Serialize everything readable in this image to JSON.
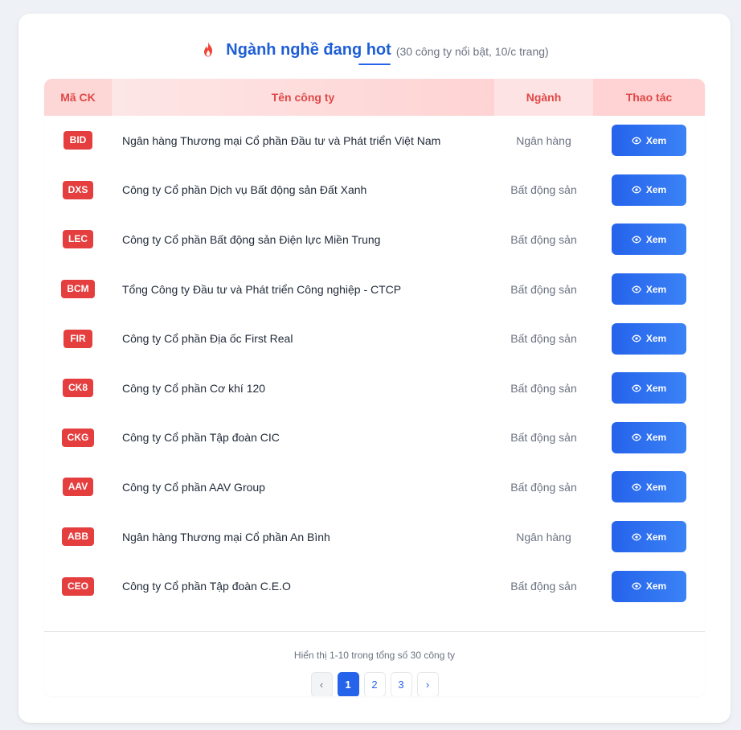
{
  "header": {
    "icon": "fire-icon",
    "title": "Ngành nghề đang hot",
    "subtitle": "(30 công ty nổi bật, 10/c trang)"
  },
  "table": {
    "columns": [
      "Mã CK",
      "Tên công ty",
      "Ngành",
      "Thao tác"
    ],
    "rows": [
      {
        "ticker": "BID",
        "name": "Ngân hàng Thương mại Cổ phần Đầu tư và Phát triển Việt Nam",
        "industry": "Ngân hàng",
        "action": "Xem"
      },
      {
        "ticker": "DXS",
        "name": "Công ty Cổ phần Dịch vụ Bất động sản Đất Xanh",
        "industry": "Bất động sản",
        "action": "Xem"
      },
      {
        "ticker": "LEC",
        "name": "Công ty Cổ phần Bất động sản Điện lực Miền Trung",
        "industry": "Bất động sản",
        "action": "Xem"
      },
      {
        "ticker": "BCM",
        "name": "Tổng Công ty Đầu tư và Phát triển Công nghiệp - CTCP",
        "industry": "Bất động sản",
        "action": "Xem"
      },
      {
        "ticker": "FIR",
        "name": "Công ty Cổ phần Địa ốc First Real",
        "industry": "Bất động sản",
        "action": "Xem"
      },
      {
        "ticker": "CK8",
        "name": "Công ty Cổ phần Cơ khí 120",
        "industry": "Bất động sản",
        "action": "Xem"
      },
      {
        "ticker": "CKG",
        "name": "Công ty Cổ phần Tập đoàn CIC",
        "industry": "Bất động sản",
        "action": "Xem"
      },
      {
        "ticker": "AAV",
        "name": "Công ty Cổ phần AAV Group",
        "industry": "Bất động sản",
        "action": "Xem"
      },
      {
        "ticker": "ABB",
        "name": "Ngân hàng Thương mại Cổ phần An Bình",
        "industry": "Ngân hàng",
        "action": "Xem"
      },
      {
        "ticker": "CEO",
        "name": "Công ty Cổ phần Tập đoàn C.E.O",
        "industry": "Bất động sản",
        "action": "Xem"
      }
    ]
  },
  "footer": {
    "summary": "Hiển thị 1-10 trong tổng số 30 công ty",
    "pagination": {
      "prev": "‹",
      "pages": [
        "1",
        "2",
        "3"
      ],
      "active": "1",
      "next": "›"
    }
  },
  "colors": {
    "accent": "#2563eb",
    "ticker": "#e53e3e",
    "header_text": "#e04848"
  }
}
